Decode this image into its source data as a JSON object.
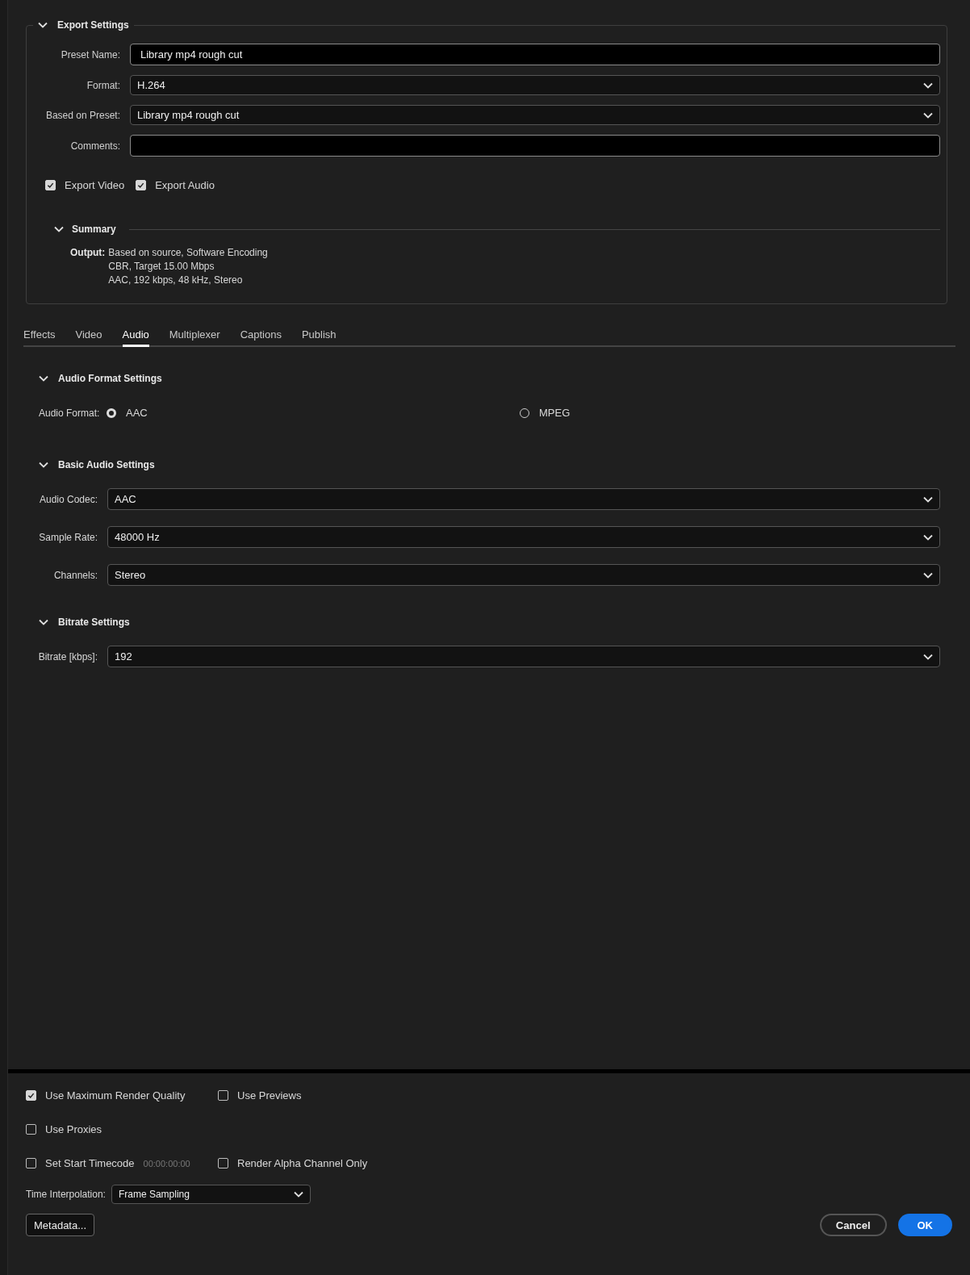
{
  "export_settings": {
    "title": "Export Settings",
    "expanded": true,
    "fields": [
      {
        "label": "Preset Name:",
        "kind": "text",
        "value": "Library mp4 rough cut"
      },
      {
        "label": "Format:",
        "kind": "dropdown",
        "value": "H.264"
      },
      {
        "label": "Based on Preset:",
        "kind": "dropdown",
        "value": "Library mp4 rough cut"
      },
      {
        "label": "Comments:",
        "kind": "text"
      }
    ],
    "checkboxes": [
      {
        "label": "Export Video",
        "checked": true
      },
      {
        "label": "Export Audio",
        "checked": true
      }
    ],
    "summary": {
      "title": "Summary",
      "expanded": true,
      "label": "Output:",
      "lines": [
        "Based on source, Software Encoding",
        "CBR, Target 15.00 Mbps",
        "AAC, 192 kbps, 48 kHz, Stereo"
      ]
    }
  },
  "tabs": [
    {
      "label": "Effects",
      "selected": false
    },
    {
      "label": "Video",
      "selected": false
    },
    {
      "label": "Audio",
      "selected": true
    },
    {
      "label": "Multiplexer",
      "selected": false
    },
    {
      "label": "Captions",
      "selected": false
    },
    {
      "label": "Publish",
      "selected": false
    }
  ],
  "sections": [
    {
      "title": "Audio Format Settings",
      "expanded": true,
      "kind": "radio",
      "label": "Audio Format:",
      "options": [
        {
          "label": "AAC",
          "selected": true
        },
        {
          "label": "MPEG",
          "selected": false
        }
      ]
    },
    {
      "title": "Basic Audio Settings",
      "expanded": true,
      "kind": "fields",
      "fields": [
        {
          "label": "Audio Codec:",
          "value": "AAC"
        },
        {
          "label": "Sample Rate:",
          "value": "48000 Hz"
        },
        {
          "label": "Channels:",
          "value": "Stereo"
        }
      ]
    },
    {
      "title": "Bitrate Settings",
      "expanded": true,
      "kind": "fields",
      "fields": [
        {
          "label": "Bitrate [kbps]:",
          "value": "192"
        }
      ]
    }
  ],
  "options": [
    [
      {
        "label": "Use Maximum Render Quality",
        "checked": true
      },
      {
        "label": "Use Previews",
        "checked": false
      }
    ],
    [
      {
        "label": "Use Proxies",
        "checked": false
      }
    ],
    [
      {
        "label": "Set Start Timecode",
        "checked": false,
        "timecode": "00:00:00:00"
      },
      {
        "label": "Render Alpha Channel Only",
        "checked": false
      }
    ]
  ],
  "time_interpolation": {
    "label": "Time Interpolation:",
    "value": "Frame Sampling"
  },
  "buttons": [
    {
      "label": "Metadata...",
      "kind": "secondary"
    },
    {
      "label": "Cancel",
      "kind": "outline"
    },
    {
      "label": "OK",
      "kind": "primary"
    }
  ]
}
